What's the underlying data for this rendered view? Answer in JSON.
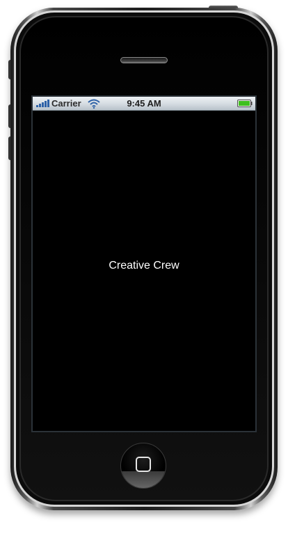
{
  "device": {
    "model_icon": "iphone-frame"
  },
  "status_bar": {
    "carrier": "Carrier",
    "time": "9:45 AM",
    "signal_icon": "signal-bars-icon",
    "wifi_icon": "wifi-icon",
    "battery_icon": "battery-icon",
    "battery_color": "#3fbf1f"
  },
  "screen": {
    "background_color": "#000000",
    "label": "Creative Crew"
  },
  "home_button": {
    "icon": "home-square-icon"
  }
}
